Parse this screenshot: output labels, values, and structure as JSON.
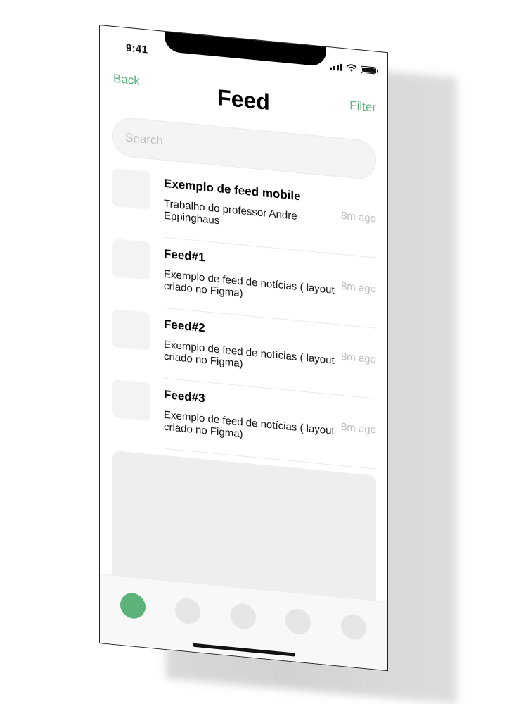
{
  "status_bar": {
    "time": "9:41"
  },
  "header": {
    "back_label": "Back",
    "title": "Feed",
    "filter_label": "Filter"
  },
  "search": {
    "placeholder": "Search"
  },
  "feed": {
    "items": [
      {
        "title": "Exemplo de feed mobile",
        "description": "Trabalho do professor Andre Eppinghaus",
        "time": "8m ago"
      },
      {
        "title": "Feed#1",
        "description": "Exemplo de feed de notícias ( layout criado no Figma)",
        "time": "8m ago"
      },
      {
        "title": "Feed#2",
        "description": "Exemplo de feed de notícias ( layout criado no Figma)",
        "time": "8m ago"
      },
      {
        "title": "Feed#3",
        "description": "Exemplo de feed de notícias ( layout criado no Figma)",
        "time": "8m ago"
      }
    ]
  },
  "tabbar": {
    "tabs": [
      "tab-1-icon",
      "tab-2-icon",
      "tab-3-icon",
      "tab-4-icon",
      "tab-5-icon"
    ],
    "active_index": 0
  },
  "colors": {
    "accent": "#5bb37a",
    "placeholder_gray": "#bdbdbd",
    "card_gray": "#eeeeee"
  }
}
